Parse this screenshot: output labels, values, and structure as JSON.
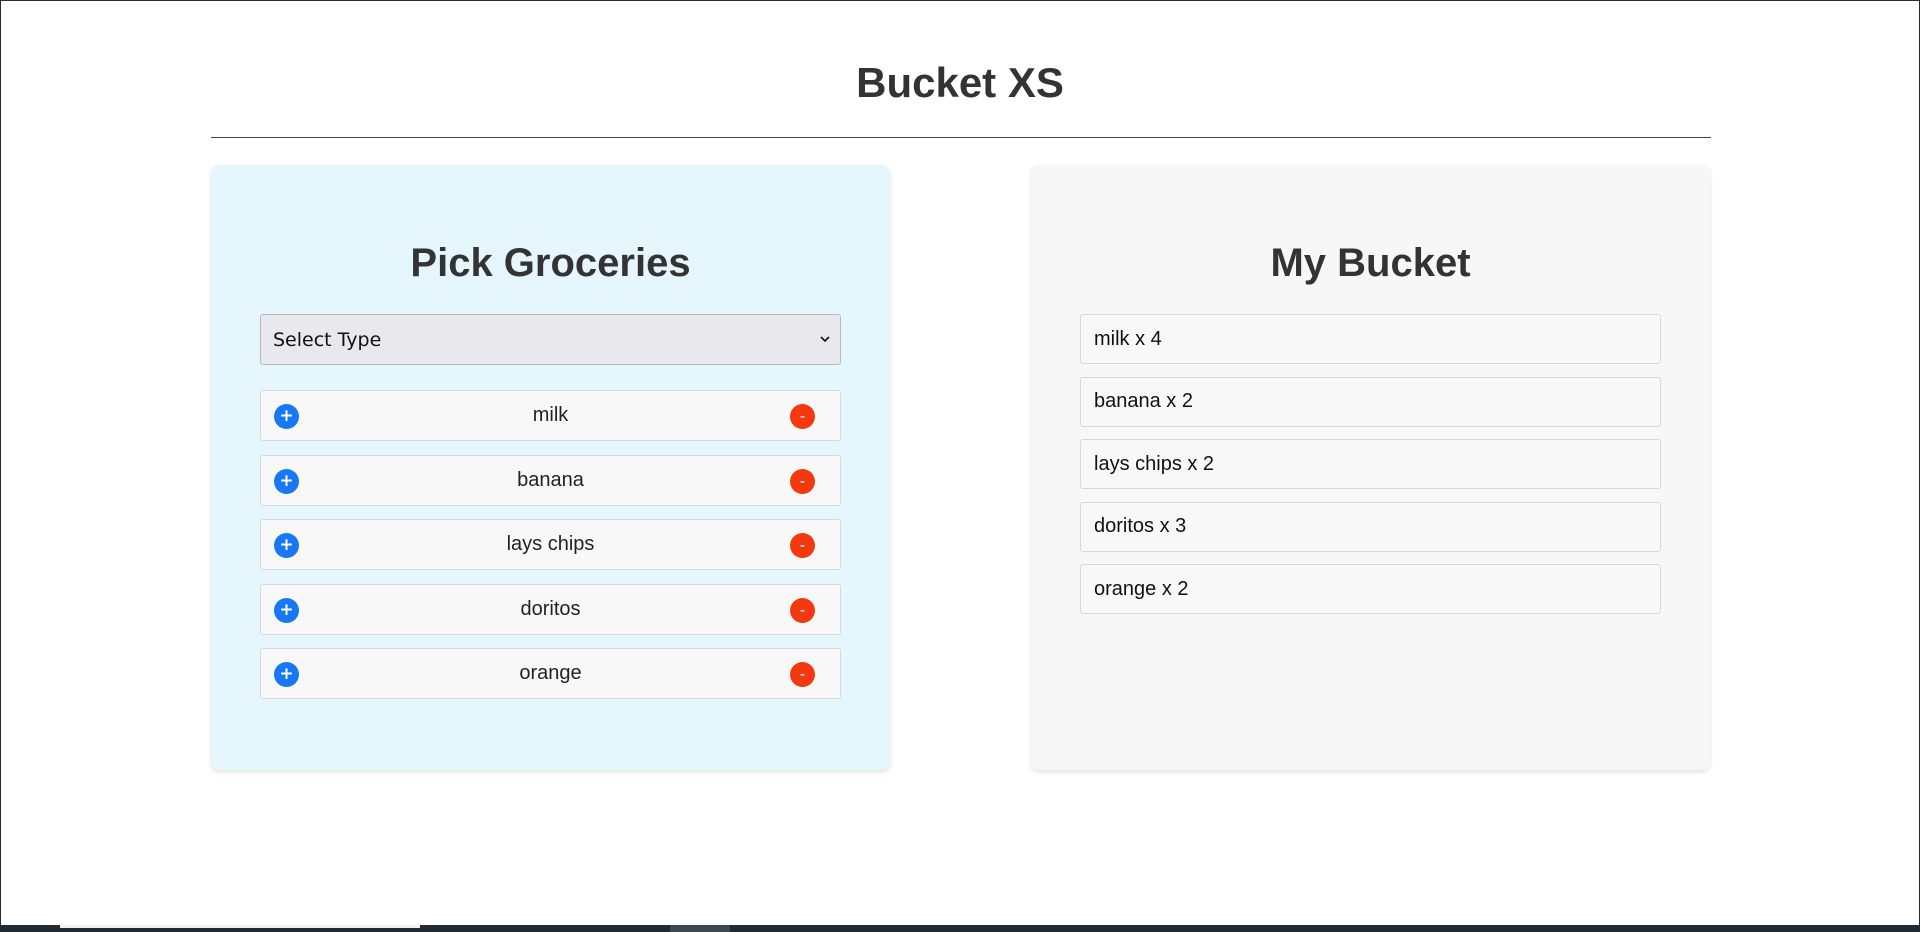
{
  "app": {
    "title": "Bucket XS"
  },
  "pick_panel": {
    "title": "Pick Groceries",
    "select": {
      "selected": "Select Type"
    },
    "add_label": "+",
    "remove_label": "-",
    "items": [
      {
        "label": "milk"
      },
      {
        "label": "banana"
      },
      {
        "label": "lays chips"
      },
      {
        "label": "doritos"
      },
      {
        "label": "orange"
      }
    ]
  },
  "bucket_panel": {
    "title": "My Bucket",
    "items": [
      {
        "text": "milk x 4"
      },
      {
        "text": "banana x 2"
      },
      {
        "text": "lays chips x 2"
      },
      {
        "text": "doritos x 3"
      },
      {
        "text": "orange x 2"
      }
    ]
  },
  "colors": {
    "add_button": "#1877f2",
    "remove_button": "#f4380f",
    "pick_panel_bg": "#e6f6fd",
    "bucket_panel_bg": "#f7f7f7"
  },
  "icons": {
    "add": "plus-icon",
    "remove": "minus-icon",
    "select": "chevron-down-icon"
  }
}
